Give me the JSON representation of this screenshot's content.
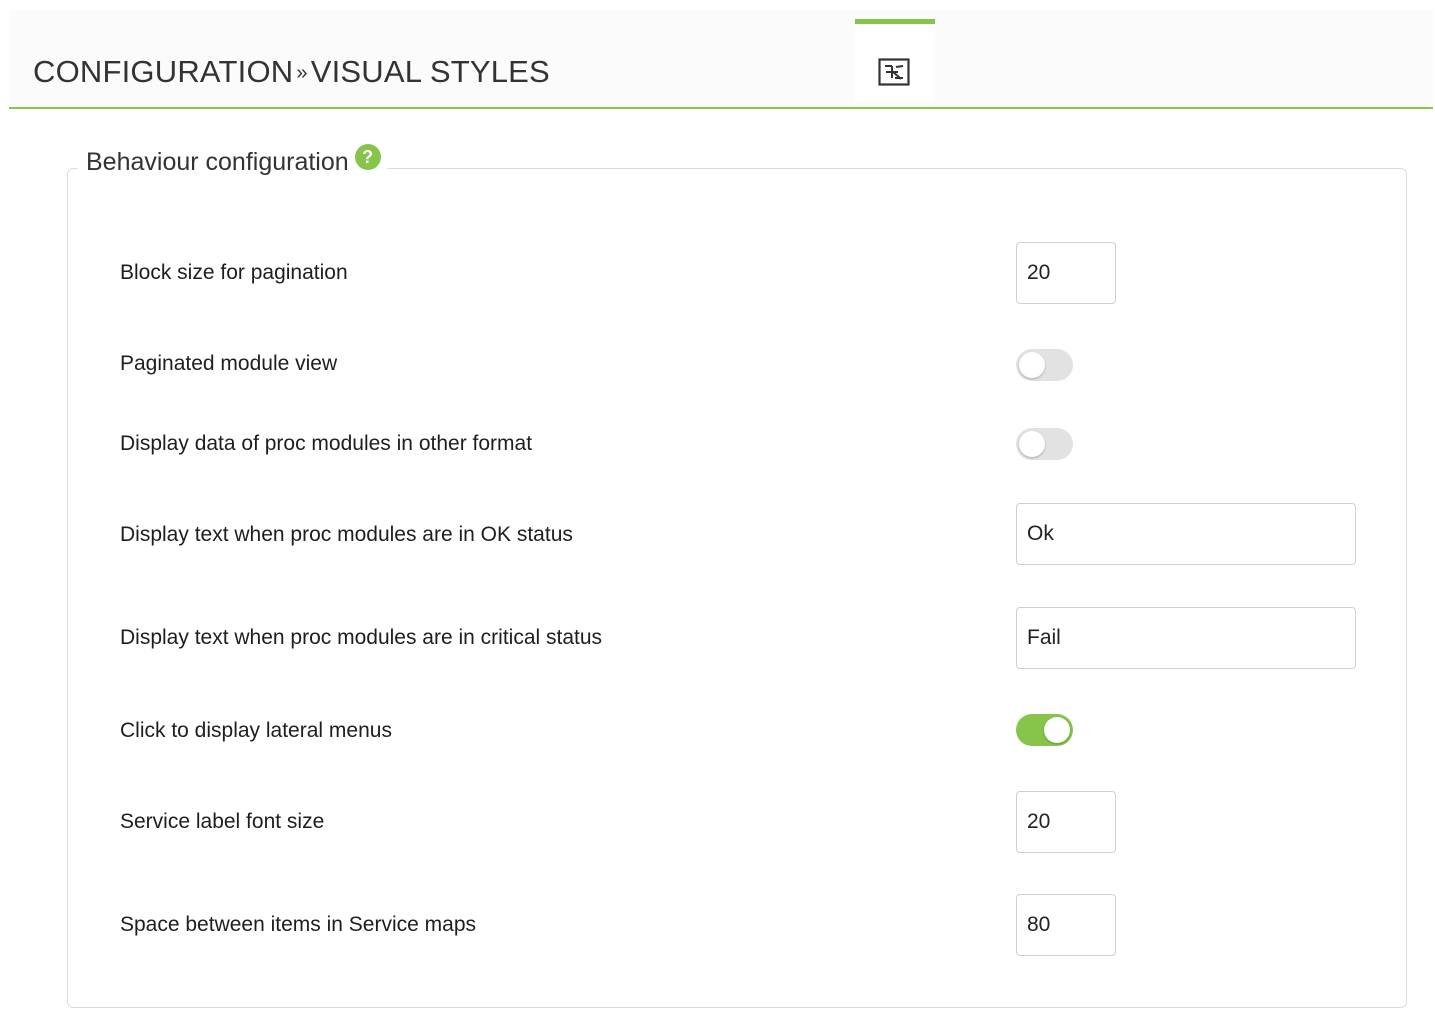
{
  "header": {
    "title_part1": "CONFIGURATION",
    "separator": "»",
    "title_part2": "VISUAL STYLES",
    "tab_icon": "visual-styles-tab-icon",
    "accent_color": "#86c54a"
  },
  "fieldset": {
    "legend": "Behaviour configuration",
    "help_icon": "help-icon",
    "help_glyph": "?"
  },
  "rows": [
    {
      "label": "Block size for pagination",
      "type": "input",
      "value": "20"
    },
    {
      "label": "Paginated module view",
      "type": "toggle",
      "checked": false
    },
    {
      "label": "Display data of proc modules in other format",
      "type": "toggle",
      "checked": false
    },
    {
      "label": "Display text when proc modules are in OK status",
      "type": "input",
      "value": "Ok"
    },
    {
      "label": "Display text when proc modules are in critical status",
      "type": "input",
      "value": "Fail"
    },
    {
      "label": "Click to display lateral menus",
      "type": "toggle",
      "checked": true
    },
    {
      "label": "Service label font size",
      "type": "input",
      "value": "20"
    },
    {
      "label": "Space between items in Service maps",
      "type": "input",
      "value": "80"
    }
  ]
}
